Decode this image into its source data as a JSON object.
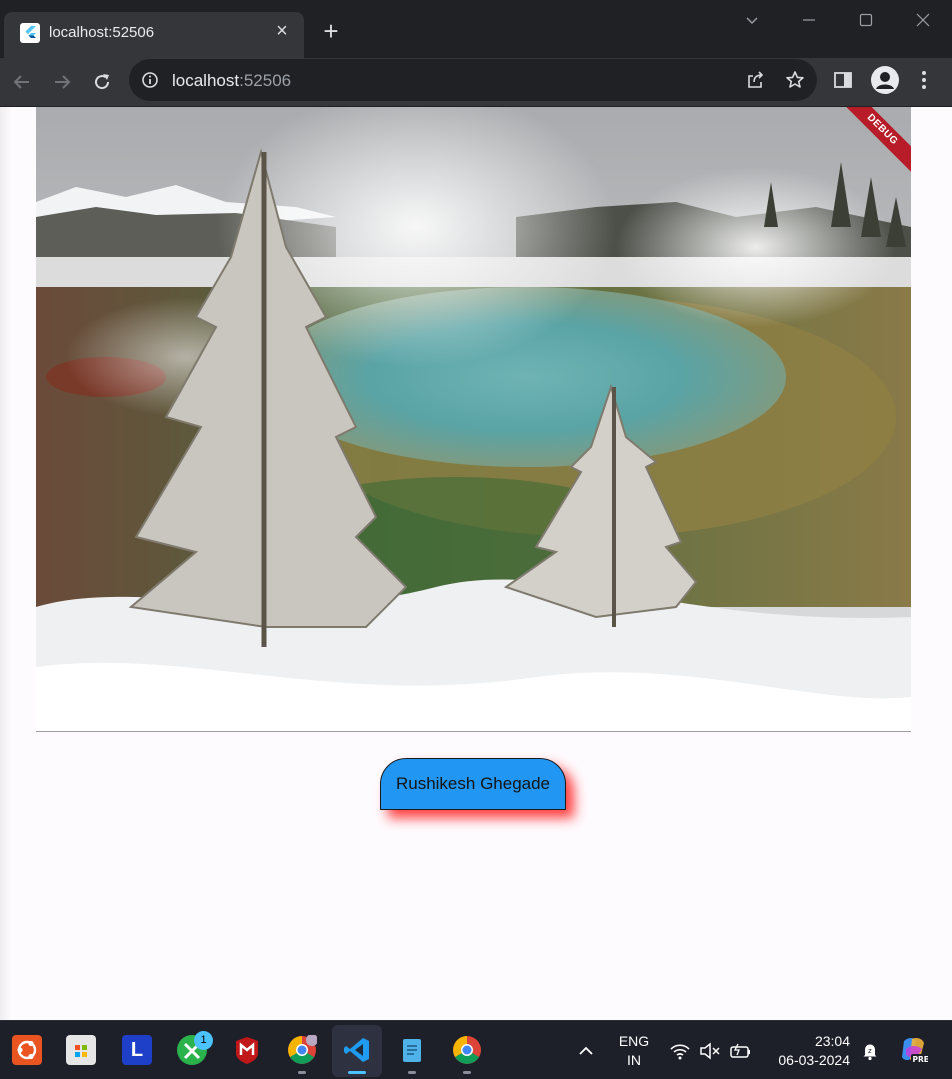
{
  "browser": {
    "tab": {
      "title": "localhost:52506",
      "favicon": "flutter-icon",
      "close_icon": "×"
    },
    "new_tab_icon": "+",
    "address": {
      "host": "localhost",
      "port": ":52506"
    }
  },
  "page": {
    "debug_banner": "DEBUG",
    "image_alt": "Steaming hot spring with frosted pine trees in snowy landscape",
    "button": {
      "label": "Rushikesh Ghegade",
      "color": "#2196f3",
      "shadow_color": "#ff1e1e"
    }
  },
  "taskbar": {
    "apps": [
      {
        "name": "ubuntu-icon"
      },
      {
        "name": "microsoft-store-icon"
      },
      {
        "name": "l-app-icon",
        "text": "L"
      },
      {
        "name": "xbox-icon",
        "badge": "1"
      },
      {
        "name": "mcafee-icon"
      },
      {
        "name": "chrome-profile-icon"
      },
      {
        "name": "vscode-icon",
        "active": true
      },
      {
        "name": "notepad-icon"
      },
      {
        "name": "chrome-icon"
      }
    ],
    "language": {
      "line1": "ENG",
      "line2": "IN"
    },
    "clock": {
      "time": "23:04",
      "date": "06-03-2024"
    },
    "copilot_badge": "PRE"
  }
}
